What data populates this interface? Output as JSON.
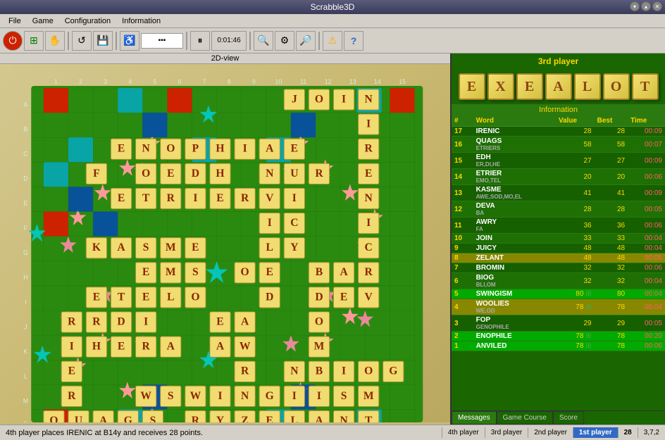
{
  "window": {
    "title": "Scrabble3D",
    "controls": [
      "minimize",
      "maximize",
      "close"
    ]
  },
  "menubar": {
    "items": [
      "File",
      "Game",
      "Configuration",
      "Information"
    ]
  },
  "toolbar": {
    "buttons": [
      {
        "name": "power",
        "icon": "⏻"
      },
      {
        "name": "grid",
        "icon": "⊞"
      },
      {
        "name": "hand",
        "icon": "✋"
      },
      {
        "name": "refresh",
        "icon": "↺"
      },
      {
        "name": "save",
        "icon": "💾"
      },
      {
        "name": "accessibility",
        "icon": "♿"
      },
      {
        "name": "pause",
        "icon": "⏸"
      },
      {
        "name": "timer",
        "icon": "0:01:46"
      },
      {
        "name": "zoom-out",
        "icon": "🔍"
      },
      {
        "name": "settings",
        "icon": "⚙"
      },
      {
        "name": "zoom-in",
        "icon": "🔎"
      },
      {
        "name": "alert",
        "icon": "⚠"
      },
      {
        "name": "help",
        "icon": "?"
      }
    ]
  },
  "board_view": {
    "label": "2D-view"
  },
  "right_panel": {
    "player_label": "3rd player",
    "rack_tiles": [
      "E",
      "X",
      "E",
      "A",
      "L",
      "O",
      "T"
    ],
    "info_label": "Information"
  },
  "info_table": {
    "headers": [
      "#",
      "Word",
      "Value",
      "Best",
      "Time"
    ],
    "rows": [
      {
        "num": "17",
        "word": "IRENIC",
        "sub": "",
        "value": "28",
        "best": "28",
        "time": "00:09",
        "highlight": ""
      },
      {
        "num": "16",
        "word": "QUAGS",
        "sub": "ETRIERS",
        "value": "58",
        "best": "58",
        "time": "00:07",
        "highlight": ""
      },
      {
        "num": "15",
        "word": "EDH",
        "sub": "ER,DI,HE",
        "value": "27",
        "best": "27",
        "time": "00:09",
        "highlight": ""
      },
      {
        "num": "14",
        "word": "ETRIER",
        "sub": "EMO,TEL",
        "value": "20",
        "best": "20",
        "time": "00:06",
        "highlight": ""
      },
      {
        "num": "13",
        "word": "KASME",
        "sub": "AWE,SOD,MO,EL",
        "value": "41",
        "best": "41",
        "time": "00:09",
        "highlight": ""
      },
      {
        "num": "12",
        "word": "DEVA",
        "sub": "BA",
        "value": "28",
        "best": "28",
        "time": "00:05",
        "highlight": ""
      },
      {
        "num": "11",
        "word": "AWRY",
        "sub": "FA",
        "value": "36",
        "best": "36",
        "time": "00:06",
        "highlight": ""
      },
      {
        "num": "10",
        "word": "JOIN",
        "sub": "",
        "value": "33",
        "best": "33",
        "time": "00:04",
        "highlight": ""
      },
      {
        "num": "9",
        "word": "JUICY",
        "sub": "",
        "value": "48",
        "best": "48",
        "time": "00:04",
        "highlight": ""
      },
      {
        "num": "8",
        "word": "ZELANT",
        "sub": "",
        "value": "48",
        "best": "48",
        "time": "00:05",
        "highlight": "yellow"
      },
      {
        "num": "7",
        "word": "BROMIN",
        "sub": "",
        "value": "32",
        "best": "32",
        "time": "00:06",
        "highlight": ""
      },
      {
        "num": "6",
        "word": "BIOG",
        "sub": "BLI,OM",
        "value": "32",
        "best": "32",
        "time": "00:04",
        "highlight": ""
      },
      {
        "num": "5",
        "word": "SWINGISM",
        "sub": "",
        "value": "80",
        "best": "80",
        "time": "00:04",
        "highlight": "green",
        "has_icon": true
      },
      {
        "num": "4",
        "word": "WOOLIES",
        "sub": "WE,OD",
        "value": "78",
        "best": "78",
        "time": "00:04",
        "highlight": "yellow",
        "has_icon": true
      },
      {
        "num": "3",
        "word": "FOP",
        "sub": "GENOPHILE",
        "value": "29",
        "best": "29",
        "time": "00:05",
        "highlight": ""
      },
      {
        "num": "2",
        "word": "ENOPHILE",
        "sub": "",
        "value": "78",
        "best": "78",
        "time": "00:20",
        "highlight": "green",
        "has_icon": true
      },
      {
        "num": "1",
        "word": "ANVILED",
        "sub": "",
        "value": "78",
        "best": "78",
        "time": "00:06",
        "highlight": "green",
        "has_icon": true
      }
    ]
  },
  "bottom_tabs": [
    "Messages",
    "Game Course",
    "Score"
  ],
  "statusbar": {
    "left": "4th player places IRENIC at B14y and receives 28 points.",
    "players": [
      {
        "label": "4th player",
        "active": false
      },
      {
        "label": "3rd player",
        "active": false
      },
      {
        "label": "2nd player",
        "active": false
      },
      {
        "label": "1st player",
        "active": true
      }
    ],
    "score": "28",
    "coords": "3,7,2"
  },
  "colors": {
    "board_green": "#2a8a10",
    "tile_yellow": "#f0e060",
    "accent_gold": "#ffd700",
    "special_red": "#cc0000",
    "special_blue": "#0044cc",
    "special_cyan": "#00aaaa",
    "special_pink": "#ee88aa"
  }
}
